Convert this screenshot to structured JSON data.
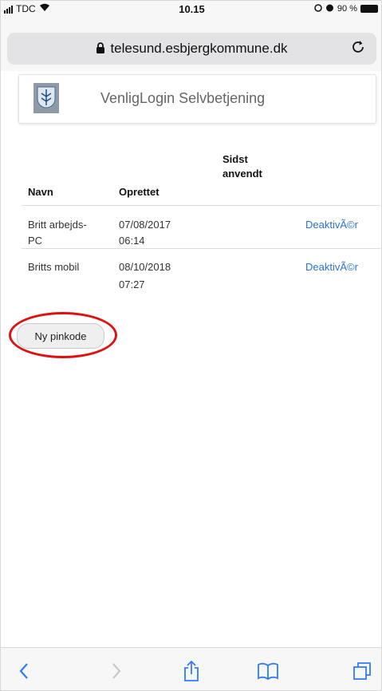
{
  "status_bar": {
    "carrier": "TDC",
    "time": "10.15",
    "battery": "90 %"
  },
  "browser": {
    "url": "telesund.esbjergkommune.dk",
    "icons": {
      "lock": "lock-icon",
      "reload": "reload-icon"
    }
  },
  "header": {
    "title": "VenligLogin Selvbetjening",
    "logo": "coat-of-arms-logo"
  },
  "table": {
    "columns": [
      "Navn",
      "Oprettet",
      "Sidst anvendt"
    ],
    "rows": [
      {
        "name_line1": "Britt arbejds-",
        "name_line2": "PC",
        "created_date": "07/08/2017",
        "created_time": "06:14",
        "last_used": "",
        "action": "DeaktivÃ©r"
      },
      {
        "name_line1": "Britts mobil",
        "name_line2": "",
        "created_date": "08/10/2018",
        "created_time": "07:27",
        "last_used": "",
        "action": "DeaktivÃ©r"
      }
    ]
  },
  "actions": {
    "new_pin_label": "Ny pinkode"
  },
  "toolbar": {
    "items": [
      "back-icon",
      "forward-icon",
      "share-icon",
      "bookmarks-icon",
      "tabs-icon"
    ]
  },
  "colors": {
    "link": "#2b74c8",
    "annotation": "#e01010",
    "toolbar_icon": "#2f7cf6"
  }
}
